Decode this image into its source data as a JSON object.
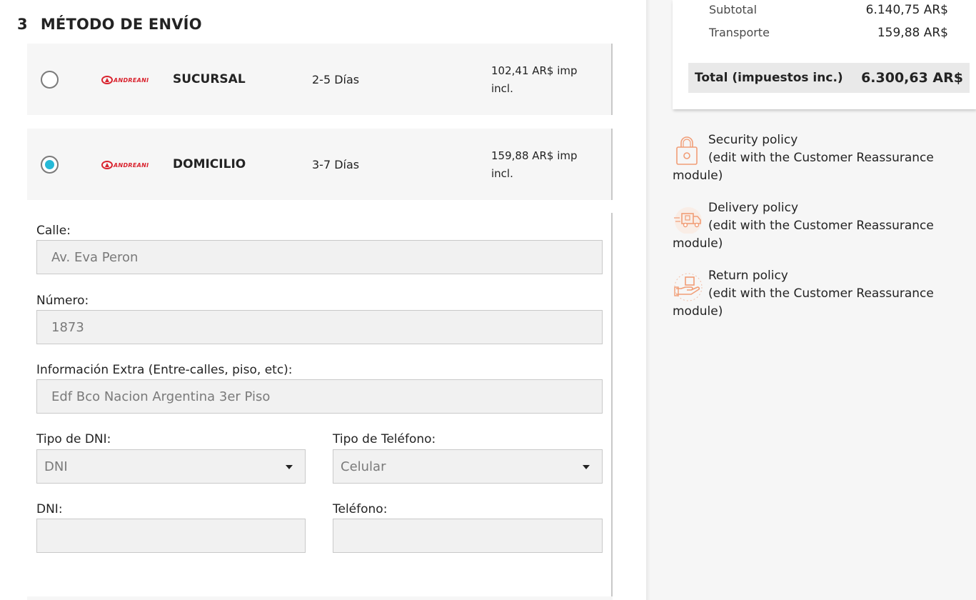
{
  "step": {
    "number": "3",
    "title": "MÉTODO DE ENVÍO"
  },
  "carriers": [
    {
      "logo_text": "ANDREANI",
      "name": "SUCURSAL",
      "days": "2-5 Días",
      "price_line1": "102,41 AR$ imp",
      "price_line2": "incl.",
      "selected": false
    },
    {
      "logo_text": "ANDREANI",
      "name": "DOMICILIO",
      "days": "3-7 Días",
      "price_line1": "159,88 AR$ imp",
      "price_line2": "incl.",
      "selected": true
    }
  ],
  "form": {
    "calle": {
      "label": "Calle:",
      "value": "Av. Eva Peron"
    },
    "numero": {
      "label": "Número:",
      "value": "1873"
    },
    "extra": {
      "label": "Información Extra (Entre-calles, piso, etc):",
      "value": "Edf Bco Nacion Argentina 3er Piso"
    },
    "tipo_dni": {
      "label": "Tipo de DNI:",
      "value": "DNI"
    },
    "tipo_telefono": {
      "label": "Tipo de Teléfono:",
      "value": "Celular"
    },
    "dni": {
      "label": "DNI:",
      "value": ""
    },
    "telefono": {
      "label": "Teléfono:",
      "value": ""
    }
  },
  "summary": {
    "subtotal_label": "Subtotal",
    "subtotal_value": "6.140,75 AR$",
    "transport_label": "Transporte",
    "transport_value": "159,88 AR$",
    "total_label": "Total (impuestos inc.)",
    "total_value": "6.300,63 AR$"
  },
  "reassurance": [
    {
      "icon": "lock-icon",
      "title": "Security policy",
      "sub": "(edit with the Customer Reassurance",
      "tail": "module)"
    },
    {
      "icon": "truck-icon",
      "title": "Delivery policy",
      "sub": "(edit with the Customer Reassurance",
      "tail": "module)"
    },
    {
      "icon": "return-box-icon",
      "title": "Return policy",
      "sub": "(edit with the Customer Reassurance",
      "tail": "module)"
    }
  ],
  "colors": {
    "accent": "#25b9d7",
    "brand_red": "#d9232e",
    "icon_orange": "#f19d76"
  }
}
